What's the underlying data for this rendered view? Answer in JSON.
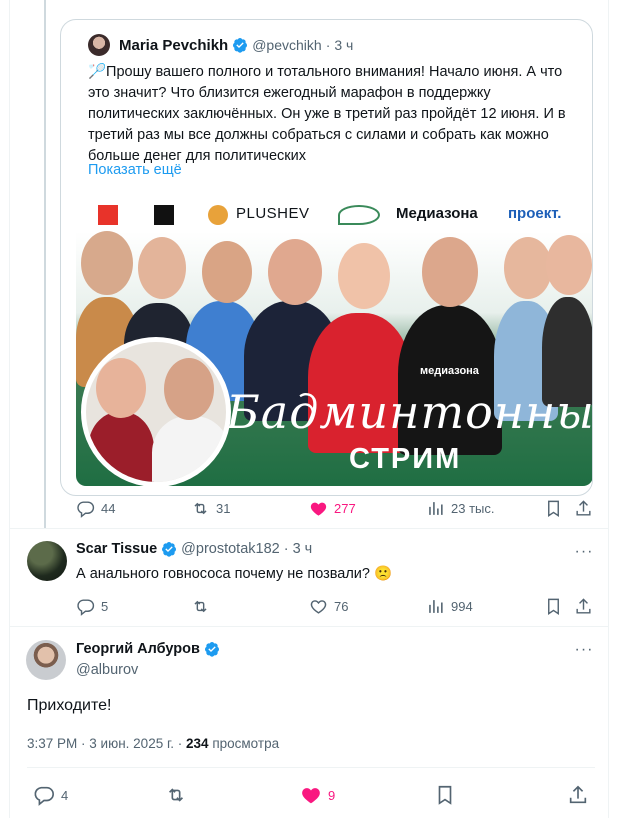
{
  "quoted_tweet": {
    "author_name": "Maria Pevchikh",
    "author_handle": "@pevchikh",
    "time": "3 ч",
    "text": "🏸Прошу вашего полного и тотального внимания! Начало июня. А что это значит? Что близится ежегодный марафон в поддержку политических заключённых. Он уже в третий раз пройдёт 12 июня. И в третий раз мы все должны собраться с силами и собрать как можно больше денег для политических",
    "show_more": "Показать ещё",
    "image": {
      "logos": [
        "PLUSHEV",
        "Медиазона",
        "проект."
      ],
      "shirt_text": "медиазона",
      "title": "Бадминтонный",
      "subtitle": "СТРИМ"
    },
    "stats": {
      "replies": "44",
      "reposts": "31",
      "likes": "277",
      "views": "23 тыс."
    }
  },
  "reply": {
    "author_name": "Scar Tissue",
    "author_handle": "@prostotak182",
    "time": "3 ч",
    "text": "А анального говнососа почему не позвали? 🙁",
    "stats": {
      "replies": "5",
      "reposts": "",
      "likes": "76",
      "views": "994"
    }
  },
  "main_tweet": {
    "author_name": "Георгий Албуров",
    "author_handle": "@alburov",
    "text": "Приходите!",
    "time": "3:37 PM",
    "date": "3 июн. 2025 г.",
    "views_count": "234",
    "views_label": "просмотра",
    "stats": {
      "replies": "4",
      "likes": "9"
    }
  },
  "colors": {
    "accent": "#1d9bf0",
    "like": "#f91880",
    "muted": "#536471",
    "border": "#cfd9de"
  },
  "icons": [
    "verified-icon",
    "reply-icon",
    "repost-icon",
    "like-icon",
    "views-icon",
    "bookmark-icon",
    "share-icon",
    "more-icon"
  ]
}
